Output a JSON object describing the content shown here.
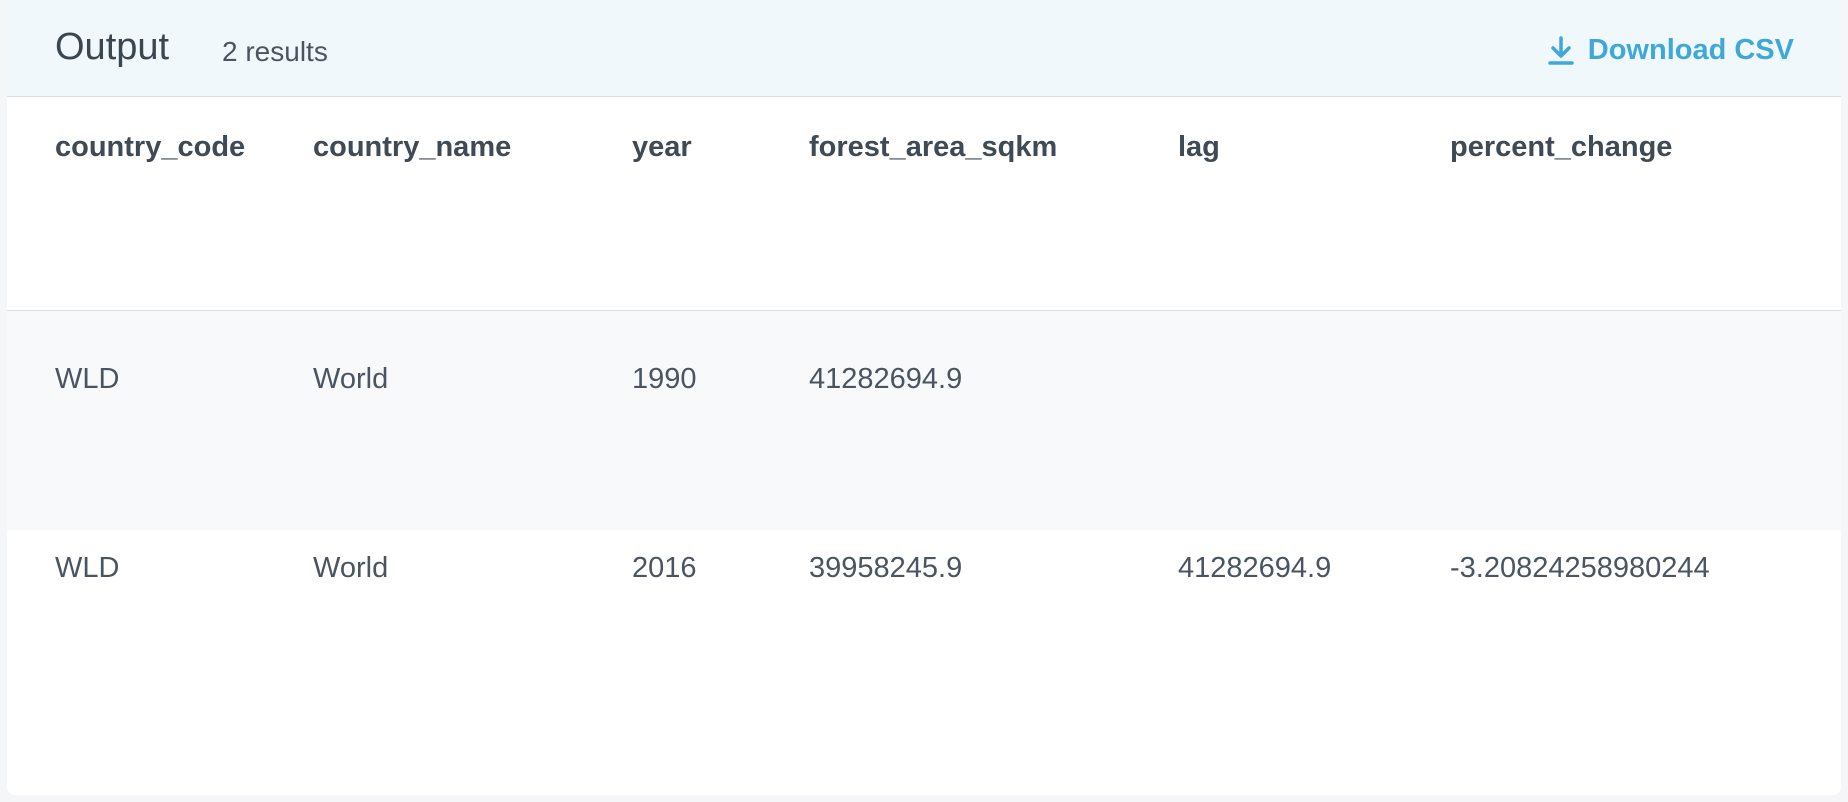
{
  "header": {
    "title": "Output",
    "count": "2 results",
    "download_label": "Download CSV",
    "download_icon": "download-icon",
    "accent_color": "#3fa8d8"
  },
  "table": {
    "columns": [
      "country_code",
      "country_name",
      "year",
      "forest_area_sqkm",
      "lag",
      "percent_change"
    ],
    "rows": [
      [
        "WLD",
        "World",
        "1990",
        "41282694.9",
        "",
        ""
      ],
      [
        "WLD",
        "World",
        "2016",
        "39958245.9",
        "41282694.9",
        "-3.20824258980244"
      ]
    ]
  }
}
